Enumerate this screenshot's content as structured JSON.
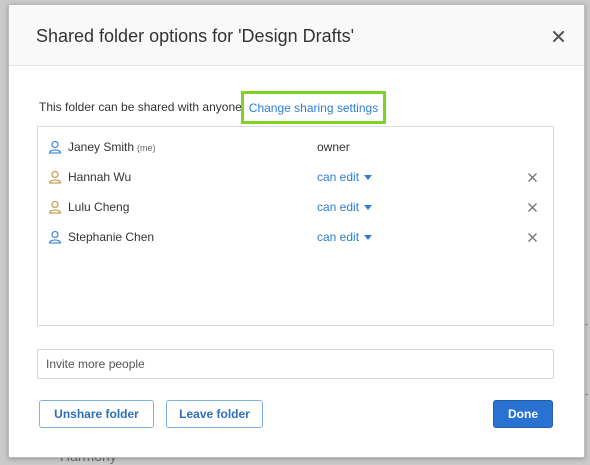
{
  "backdrop": {
    "partial_text": "Harmony"
  },
  "dialog": {
    "title": "Shared folder options for 'Design Drafts'",
    "description": "This folder can be shared with anyone.",
    "change_link_label": "Change sharing settings",
    "highlight_color": "#7ed321",
    "link_color": "#2e7ed1",
    "members": [
      {
        "name": "Janey Smith",
        "tag": "(me)",
        "role": "owner",
        "editable": false,
        "icon_color": "#4a90e2"
      },
      {
        "name": "Hannah Wu",
        "tag": "",
        "role": "can edit",
        "editable": true,
        "icon_color": "#c8a15a"
      },
      {
        "name": "Lulu Cheng",
        "tag": "",
        "role": "can edit",
        "editable": true,
        "icon_color": "#c8a15a"
      },
      {
        "name": "Stephanie Chen",
        "tag": "",
        "role": "can edit",
        "editable": true,
        "icon_color": "#4a90e2"
      }
    ],
    "invite_placeholder": "Invite more people",
    "unshare_label": "Unshare folder",
    "leave_label": "Leave folder",
    "done_label": "Done",
    "primary_color": "#2a72d2"
  }
}
